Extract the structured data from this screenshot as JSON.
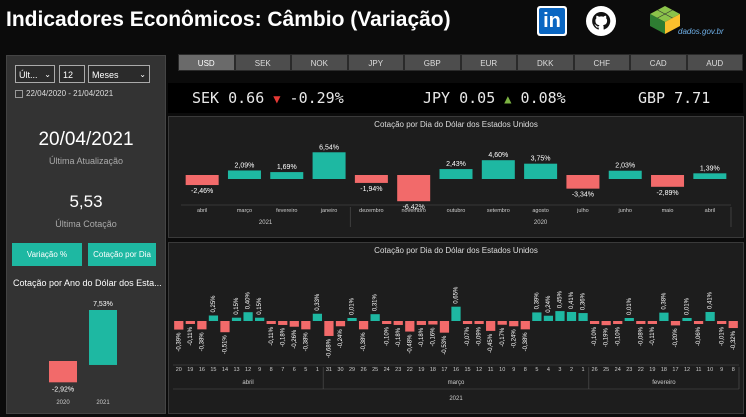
{
  "header": {
    "title": "Indicadores Econômicos: Câmbio (Variação)",
    "dados_text": "dados.gov.br"
  },
  "side": {
    "period_select": "Últ...",
    "period_number": "12",
    "period_unit": "Meses",
    "date_range": "22/04/2020 - 21/04/2021",
    "last_update_value": "20/04/2021",
    "last_update_label": "Última Atualização",
    "last_quote_value": "5,53",
    "last_quote_label": "Última Cotação",
    "btn_variation": "Variação %",
    "btn_quote_day": "Cotação por Dia",
    "year_chart_title": "Cotação por Ano do Dólar dos Esta..."
  },
  "tabs": [
    "USD",
    "SEK",
    "NOK",
    "JPY",
    "GBP",
    "EUR",
    "DKK",
    "CHF",
    "CAD",
    "AUD"
  ],
  "ticker": [
    {
      "code": "SEK",
      "value": "0.66",
      "dir": "down",
      "change": "-0.29%"
    },
    {
      "code": "JPY",
      "value": "0.05",
      "dir": "up",
      "change": "0.08%"
    },
    {
      "code": "GBP",
      "value": "7.71",
      "dir": "",
      "change": ""
    }
  ],
  "colors": {
    "positive": "#1eb8a2",
    "negative": "#f26a6a"
  },
  "chart_data": [
    {
      "type": "bar",
      "title": "Cotação por Dia do Dólar dos Estados Unidos",
      "categories": [
        "abril",
        "março",
        "fevereiro",
        "janeiro",
        "dezembro",
        "novembro",
        "outubro",
        "setembro",
        "agosto",
        "julho",
        "junho",
        "maio",
        "abril"
      ],
      "values": [
        -2.46,
        2.09,
        1.69,
        6.54,
        -1.94,
        -6.42,
        2.43,
        4.6,
        3.75,
        -3.34,
        2.03,
        -2.89,
        1.39
      ],
      "labels": [
        "-2,46%",
        "2,09%",
        "1,69%",
        "6,54%",
        "-1,94%",
        "-6,42%",
        "2,43%",
        "4,60%",
        "3,75%",
        "-3,34%",
        "2,03%",
        "-2,89%",
        "1,39%"
      ],
      "year_groups": [
        {
          "label": "2021",
          "span": 4
        },
        {
          "label": "2020",
          "span": 9
        }
      ]
    },
    {
      "type": "bar",
      "title": "Cotação por Dia do Dólar dos Estados Unidos",
      "categories": [
        "20",
        "19",
        "16",
        "15",
        "14",
        "13",
        "12",
        "9",
        "8",
        "7",
        "6",
        "5",
        "1",
        "31",
        "30",
        "29",
        "26",
        "25",
        "24",
        "23",
        "22",
        "19",
        "18",
        "17",
        "16",
        "15",
        "12",
        "11",
        "10",
        "9",
        "8",
        "5",
        "4",
        "3",
        "2",
        "1",
        "26",
        "25",
        "24",
        "23",
        "22",
        "19",
        "18",
        "17",
        "12",
        "11",
        "10",
        "9",
        "8"
      ],
      "values": [
        -0.39,
        -0.11,
        -0.38,
        0.25,
        -0.51,
        0.15,
        0.4,
        0.15,
        -0.11,
        -0.18,
        -0.26,
        -0.38,
        0.33,
        -0.68,
        -0.24,
        0.01,
        -0.38,
        0.31,
        -0.1,
        -0.18,
        -0.48,
        -0.18,
        -0.16,
        -0.53,
        0.65,
        -0.07,
        -0.09,
        -0.45,
        -0.17,
        -0.24,
        -0.38,
        0.39,
        0.24,
        0.45,
        0.41,
        0.36,
        -0.1,
        -0.19,
        -0.1,
        0.01,
        -0.08,
        -0.11,
        0.38,
        -0.2,
        0.01,
        -0.06,
        0.41,
        -0.01,
        -0.32
      ],
      "labels": [
        "-0,39%",
        "-0,11%",
        "-0,38%",
        "0,25%",
        "-0,51%",
        "0,15%",
        "0,40%",
        "0,15%",
        "-0,11%",
        "-0,18%",
        "-0,26%",
        "-0,38%",
        "0,33%",
        "-0,68%",
        "-0,24%",
        "0,01%",
        "-0,38%",
        "0,31%",
        "-0,10%",
        "-0,18%",
        "-0,48%",
        "-0,18%",
        "-0,16%",
        "-0,53%",
        "0,65%",
        "-0,07%",
        "-0,09%",
        "-0,45%",
        "-0,17%",
        "-0,24%",
        "-0,38%",
        "0,39%",
        "0,24%",
        "0,45%",
        "0,41%",
        "0,36%",
        "-0,10%",
        "-0,19%",
        "-0,10%",
        "0,01%",
        "-0,08%",
        "-0,11%",
        "0,38%",
        "-0,20%",
        "0,01%",
        "-0,06%",
        "0,41%",
        "-0,01%",
        "-0,32%"
      ],
      "month_groups": [
        {
          "label": "abril",
          "span": 13
        },
        {
          "label": "março",
          "span": 23
        },
        {
          "label": "fevereiro",
          "span": 13
        }
      ],
      "year_label": "2021"
    },
    {
      "type": "bar",
      "title": "Cotação por Ano do Dólar dos Esta...",
      "categories": [
        "2020",
        "2021"
      ],
      "values": [
        -2.92,
        7.53
      ],
      "labels": [
        "-2,92%",
        "7,53%"
      ]
    }
  ]
}
